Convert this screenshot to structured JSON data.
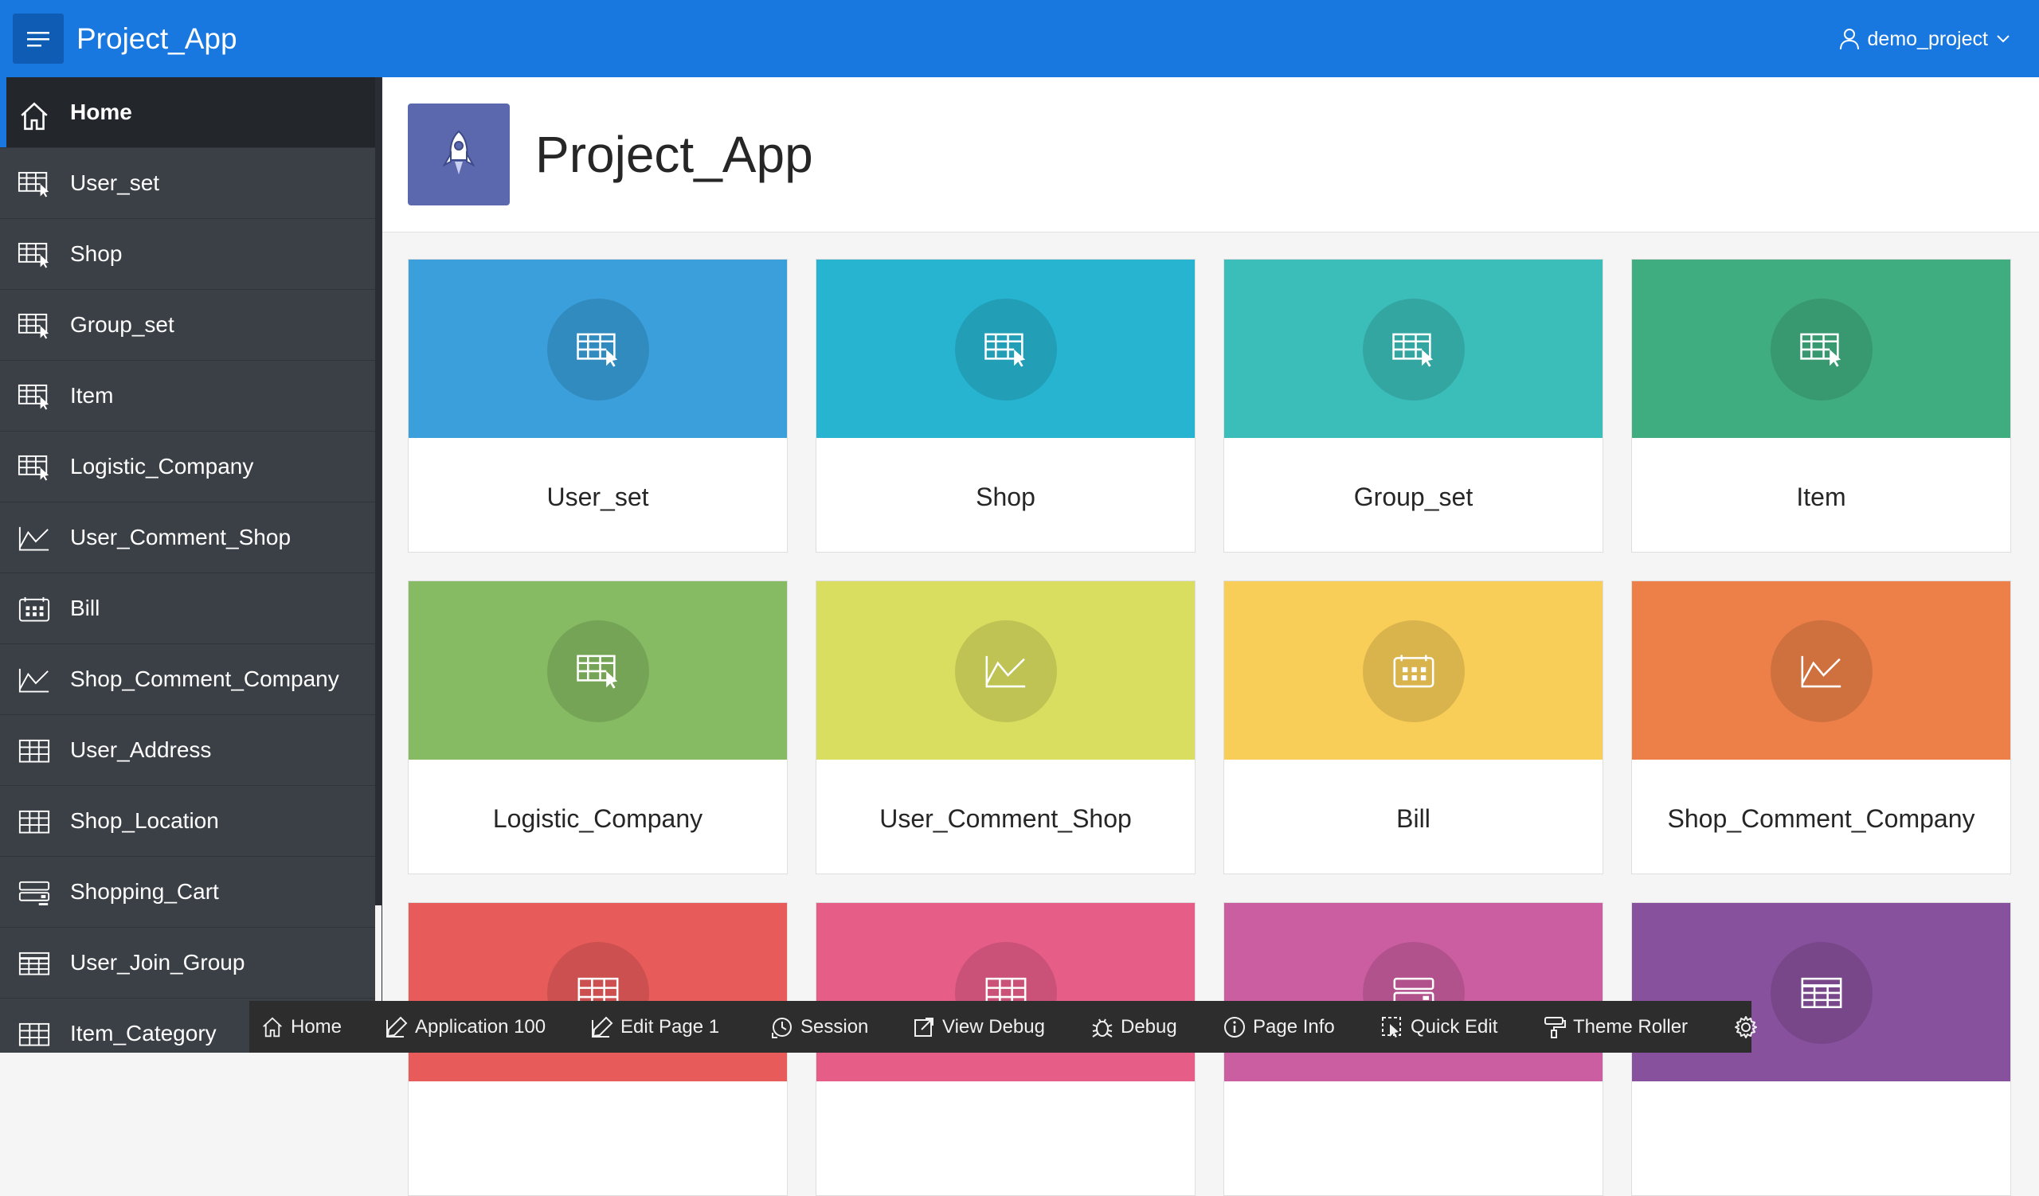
{
  "header": {
    "app_title": "Project_App",
    "menu_icon": "hamburger-icon",
    "user_name": "demo_project",
    "user_icon": "user-icon"
  },
  "sidebar": {
    "items": [
      {
        "label": "Home",
        "icon": "home-icon",
        "active": true
      },
      {
        "label": "User_set",
        "icon": "table-cursor-icon"
      },
      {
        "label": "Shop",
        "icon": "table-cursor-icon"
      },
      {
        "label": "Group_set",
        "icon": "table-cursor-icon"
      },
      {
        "label": "Item",
        "icon": "table-cursor-icon"
      },
      {
        "label": "Logistic_Company",
        "icon": "table-cursor-icon"
      },
      {
        "label": "User_Comment_Shop",
        "icon": "line-chart-icon"
      },
      {
        "label": "Bill",
        "icon": "calendar-icon"
      },
      {
        "label": "Shop_Comment_Company",
        "icon": "line-chart-icon"
      },
      {
        "label": "User_Address",
        "icon": "grid-icon"
      },
      {
        "label": "Shop_Location",
        "icon": "grid-icon"
      },
      {
        "label": "Shopping_Cart",
        "icon": "form-icon"
      },
      {
        "label": "User_Join_Group",
        "icon": "table-icon"
      },
      {
        "label": "Item_Category",
        "icon": "grid-icon"
      }
    ]
  },
  "hero": {
    "title": "Project_App",
    "icon": "rocket-icon"
  },
  "cards": [
    {
      "title": "User_set",
      "color": "#3a9fda",
      "icon": "table-cursor-icon"
    },
    {
      "title": "Shop",
      "color": "#27b4d1",
      "icon": "table-cursor-icon"
    },
    {
      "title": "Group_set",
      "color": "#3bbdb9",
      "icon": "table-cursor-icon"
    },
    {
      "title": "Item",
      "color": "#40ad80",
      "icon": "table-cursor-icon"
    },
    {
      "title": "Logistic_Company",
      "color": "#86bb63",
      "icon": "table-cursor-icon"
    },
    {
      "title": "User_Comment_Shop",
      "color": "#dade60",
      "icon": "line-chart-icon"
    },
    {
      "title": "Bill",
      "color": "#f8cd58",
      "icon": "calendar-icon"
    },
    {
      "title": "Shop_Comment_Company",
      "color": "#ec8048",
      "icon": "line-chart-icon"
    },
    {
      "title": "",
      "color": "#e75c5a",
      "icon": "grid-icon"
    },
    {
      "title": "",
      "color": "#e65d88",
      "icon": "grid-icon"
    },
    {
      "title": "",
      "color": "#cb5ea0",
      "icon": "form-icon"
    },
    {
      "title": "",
      "color": "#88519d",
      "icon": "table-icon"
    }
  ],
  "devbar": {
    "items": [
      {
        "label": "Home",
        "icon": "home-icon"
      },
      {
        "label": "Application 100",
        "icon": "edit-icon"
      },
      {
        "label": "Edit Page 1",
        "icon": "edit-icon"
      },
      {
        "label": "Session",
        "icon": "session-icon"
      },
      {
        "label": "View Debug",
        "icon": "external-link-icon"
      },
      {
        "label": "Debug",
        "icon": "bug-icon"
      },
      {
        "label": "Page Info",
        "icon": "info-icon"
      },
      {
        "label": "Quick Edit",
        "icon": "quick-edit-icon"
      },
      {
        "label": "Theme Roller",
        "icon": "paint-roller-icon"
      },
      {
        "label": "",
        "icon": "gear-icon"
      }
    ]
  }
}
